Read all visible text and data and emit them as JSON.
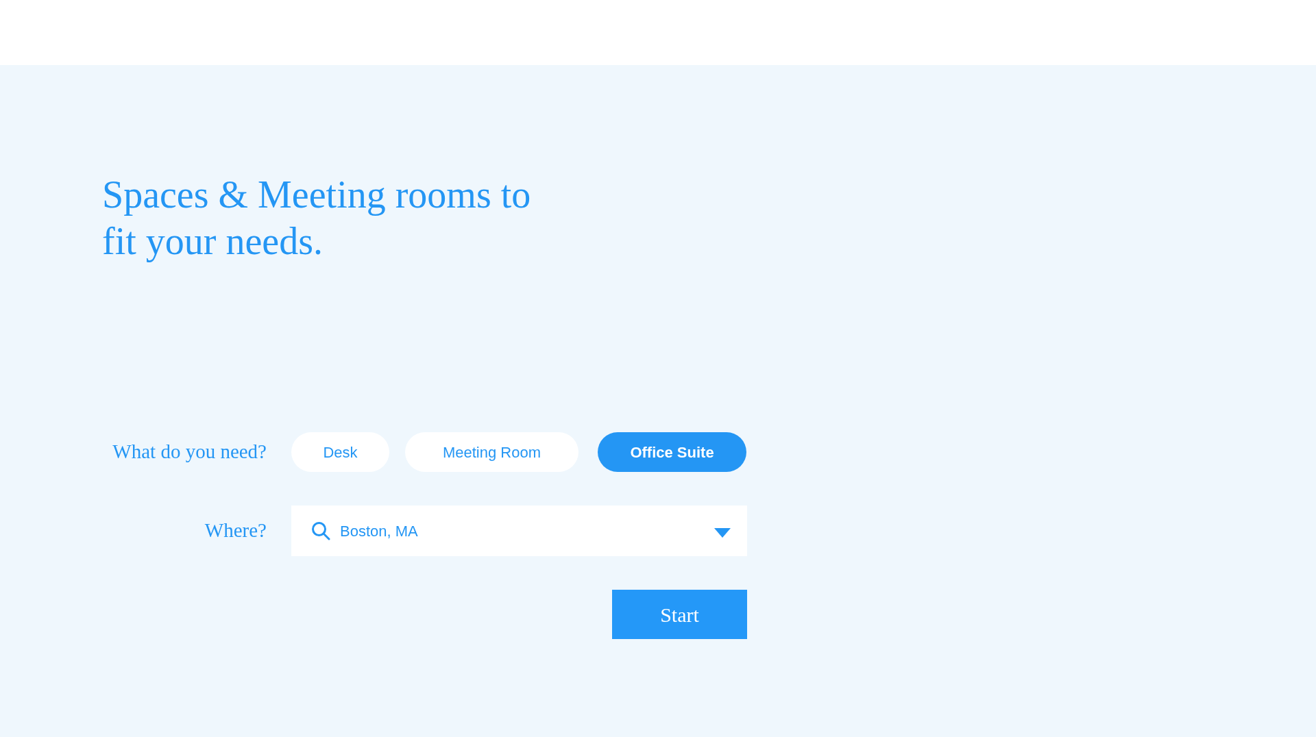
{
  "headline": "Spaces & Meeting rooms to fit your needs.",
  "need": {
    "label": "What do you need?",
    "options": [
      {
        "label": "Desk",
        "selected": false
      },
      {
        "label": "Meeting Room",
        "selected": false
      },
      {
        "label": "Office Suite",
        "selected": true
      }
    ]
  },
  "where": {
    "label": "Where?",
    "value": "Boston, MA"
  },
  "start_button": "Start"
}
